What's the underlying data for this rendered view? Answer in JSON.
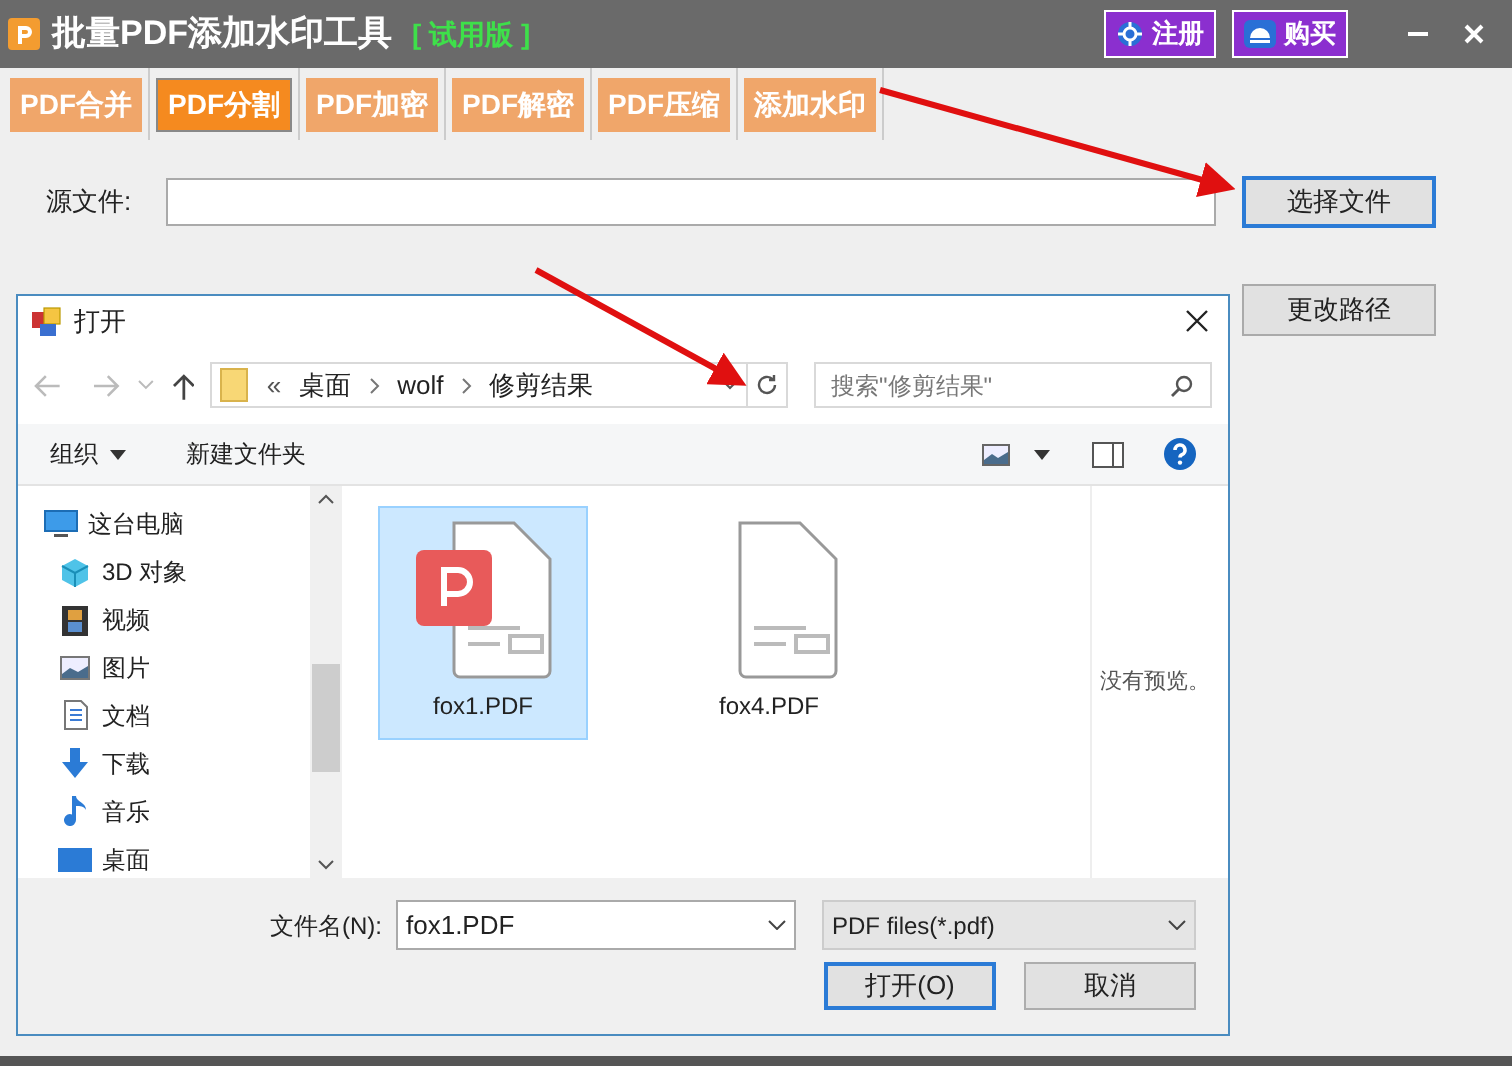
{
  "window": {
    "title": "批量PDF添加水印工具",
    "edition": "[ 试用版 ]",
    "buttons": [
      "注册",
      "购买"
    ]
  },
  "tabs": [
    {
      "label": "PDF合并",
      "selected": false
    },
    {
      "label": "PDF分割",
      "selected": true
    },
    {
      "label": "PDF加密",
      "selected": false
    },
    {
      "label": "PDF解密",
      "selected": false
    },
    {
      "label": "PDF压缩",
      "selected": false
    },
    {
      "label": "添加水印",
      "selected": false
    }
  ],
  "source": {
    "label": "源文件:",
    "button": "选择文件"
  },
  "change_path_button": "更改路径",
  "dialog": {
    "title": "打开",
    "breadcrumb": [
      "«",
      "桌面",
      "wolf",
      "修剪结果"
    ],
    "search": {
      "placeholder": "搜索\"修剪结果\""
    },
    "toolbar": [
      "组织",
      "新建文件夹"
    ],
    "nav": [
      {
        "label": "这台电脑"
      },
      {
        "label": "3D 对象"
      },
      {
        "label": "视频"
      },
      {
        "label": "图片"
      },
      {
        "label": "文档"
      },
      {
        "label": "下载"
      },
      {
        "label": "音乐"
      },
      {
        "label": "桌面"
      }
    ],
    "files": [
      {
        "name": "fox1.PDF",
        "selected": true,
        "app_badge": true
      },
      {
        "name": "fox4.PDF",
        "selected": false,
        "app_badge": false
      }
    ],
    "preview": "没有预览。",
    "filename_label": "文件名(N):",
    "filename": "fox1.PDF",
    "filter": "PDF files(*.pdf)",
    "open_button": "打开(O)",
    "cancel_button": "取消"
  }
}
